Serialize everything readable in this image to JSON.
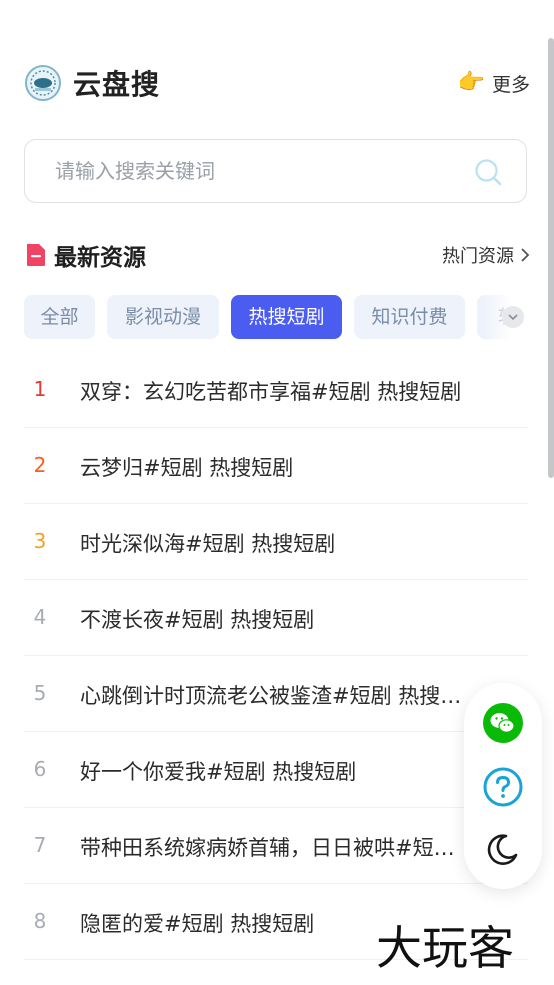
{
  "header": {
    "title": "云盘搜",
    "more_icon": "👉",
    "more_label": "更多"
  },
  "search": {
    "placeholder": "请输入搜索关键词",
    "value": ""
  },
  "section": {
    "title": "最新资源",
    "link_label": "热门资源"
  },
  "tabs": [
    {
      "label": "全部",
      "active": false
    },
    {
      "label": "影视动漫",
      "active": false
    },
    {
      "label": "热搜短剧",
      "active": true
    },
    {
      "label": "知识付费",
      "active": false
    },
    {
      "label": "软件",
      "active": false
    }
  ],
  "list": [
    {
      "rank": "1",
      "title": "双穿：玄幻吃苦都市享福#短剧 热搜短剧"
    },
    {
      "rank": "2",
      "title": "云梦归#短剧 热搜短剧"
    },
    {
      "rank": "3",
      "title": "时光深似海#短剧 热搜短剧"
    },
    {
      "rank": "4",
      "title": "不渡长夜#短剧 热搜短剧"
    },
    {
      "rank": "5",
      "title": "心跳倒计时顶流老公被鉴渣#短剧 热搜短剧"
    },
    {
      "rank": "6",
      "title": "好一个你爱我#短剧 热搜短剧"
    },
    {
      "rank": "7",
      "title": "带种田系统嫁病娇首辅，日日被哄#短剧 热搜短剧"
    },
    {
      "rank": "8",
      "title": "隐匿的爱#短剧 热搜短剧"
    }
  ],
  "floating": {
    "icons": [
      "wechat-icon",
      "help-icon",
      "dark-mode-icon"
    ]
  },
  "colors": {
    "accent": "#4b5cf0",
    "rank1": "#e53935",
    "rank2": "#ff5b22",
    "rank3": "#f5a01f",
    "wechat": "#09bb07",
    "help": "#1aa3d6"
  },
  "watermark": "大玩客"
}
